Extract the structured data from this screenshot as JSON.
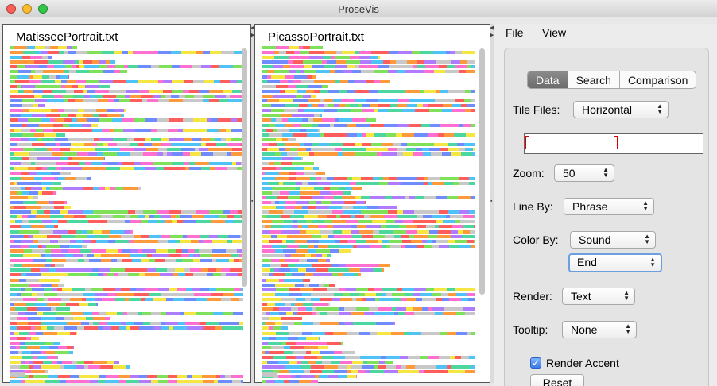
{
  "window": {
    "title": "ProseVis"
  },
  "documents": [
    {
      "filename": "MatisseePortrait.txt"
    },
    {
      "filename": "PicassoPortrait.txt"
    }
  ],
  "menu": {
    "file": "File",
    "view": "View"
  },
  "tabs": [
    "Data",
    "Search",
    "Comparison"
  ],
  "active_tab": "Data",
  "controls": {
    "tile_files_label": "Tile Files:",
    "tile_files_value": "Horizontal",
    "zoom_label": "Zoom:",
    "zoom_value": "50",
    "line_by_label": "Line By:",
    "line_by_value": "Phrase",
    "color_by_label": "Color By:",
    "color_by_value": "Sound",
    "color_by_sub_value": "End",
    "render_label": "Render:",
    "render_value": "Text",
    "tooltip_label": "Tooltip:",
    "tooltip_value": "None",
    "render_accent_label": "Render Accent",
    "render_accent_checked": true,
    "reset_label": "Reset"
  },
  "palette": [
    "#ff5c5c",
    "#ff9a3c",
    "#f5e642",
    "#7fe05a",
    "#4cd6a0",
    "#4fc3f7",
    "#6f8cff",
    "#b07cff",
    "#ff6fd0",
    "#c8c8c8"
  ]
}
